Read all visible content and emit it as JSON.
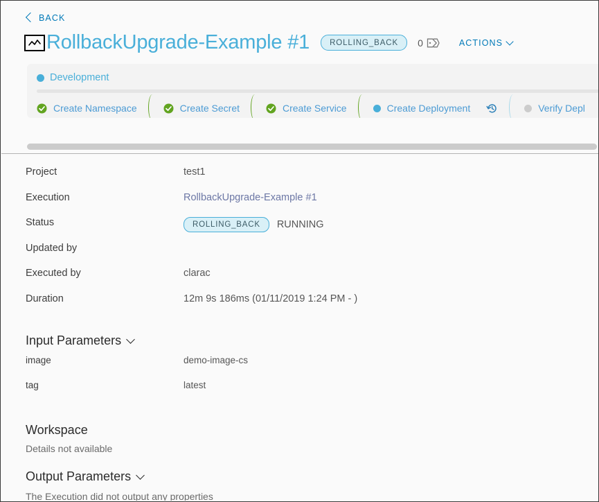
{
  "header": {
    "back_label": "BACK",
    "back_icon": "chevron-left-icon",
    "title_icon": "pipeline-chart-icon",
    "title": "RollbackUpgrade-Example #1",
    "status_badge": "ROLLING_BACK",
    "tag_count": "0",
    "tag_icon": "tag-icon",
    "actions_label": "ACTIONS",
    "actions_caret": "chevron-down-icon"
  },
  "stage": {
    "name": "Development",
    "status_dot_color": "#49afd9",
    "tasks": [
      {
        "label": "Create Namespace",
        "state": "completed",
        "icon": "check-circle-icon",
        "color": "#62a420"
      },
      {
        "label": "Create Secret",
        "state": "completed",
        "icon": "check-circle-icon",
        "color": "#62a420"
      },
      {
        "label": "Create Service",
        "state": "completed",
        "icon": "check-circle-icon",
        "color": "#62a420"
      },
      {
        "label": "Create Deployment",
        "state": "running",
        "icon": "status-dot-icon",
        "color": "#49afd9",
        "extra_icon": "history-rollback-icon"
      },
      {
        "label": "Verify Depl",
        "state": "pending",
        "icon": "status-dot-icon",
        "color": "#cccccc"
      }
    ]
  },
  "details": {
    "rows": [
      {
        "label": "Project",
        "value": "test1",
        "type": "text"
      },
      {
        "label": "Execution",
        "value": "RollbackUpgrade-Example #1",
        "type": "link"
      },
      {
        "label": "Status",
        "value": "",
        "type": "status",
        "badge": "ROLLING_BACK",
        "state": "RUNNING"
      },
      {
        "label": "Updated by",
        "value": "",
        "type": "text"
      },
      {
        "label": "Executed by",
        "value": "clarac",
        "type": "text"
      },
      {
        "label": "Duration",
        "value": "12m 9s 186ms (01/11/2019 1:24 PM - )",
        "type": "text"
      }
    ]
  },
  "input_parameters": {
    "title": "Input Parameters",
    "caret": "chevron-down-icon",
    "rows": [
      {
        "label": "image",
        "value": "demo-image-cs"
      },
      {
        "label": "tag",
        "value": "latest"
      }
    ]
  },
  "workspace": {
    "title": "Workspace",
    "note": "Details not available"
  },
  "output_parameters": {
    "title": "Output Parameters",
    "caret": "chevron-down-icon",
    "note": "The Execution did not output any properties"
  },
  "colors": {
    "accent_blue": "#49afd9",
    "link_blue": "#0079b8",
    "success_green": "#62a420",
    "pending_grey": "#cccccc",
    "badge_bg": "#d9f0f7"
  }
}
